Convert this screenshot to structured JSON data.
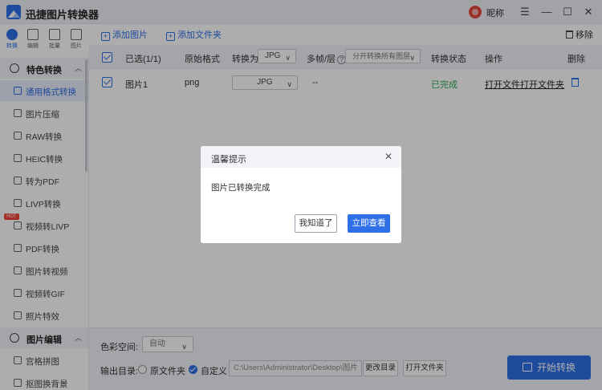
{
  "window": {
    "title": "迅捷图片转换器",
    "user_name": "昵称",
    "menu_glyph": "☰",
    "minimize_glyph": "—",
    "maximize_glyph": "☐",
    "close_glyph": "✕"
  },
  "rail": [
    {
      "label": "转换",
      "icon": "convert-icon",
      "active": true
    },
    {
      "label": "编辑",
      "icon": "edit-icon",
      "active": false
    },
    {
      "label": "批量",
      "icon": "batch-icon",
      "active": false
    },
    {
      "label": "图片",
      "icon": "image-icon",
      "active": false
    }
  ],
  "sidebar": {
    "section1": "特色转换",
    "items": [
      {
        "label": "通用格式转换",
        "active": true
      },
      {
        "label": "图片压缩"
      },
      {
        "label": "RAW转换"
      },
      {
        "label": "HEIC转换"
      },
      {
        "label": "转为PDF"
      },
      {
        "label": "LIVP转换"
      },
      {
        "label": "视频转LIVP",
        "badge": "HOT"
      },
      {
        "label": "PDF转换"
      },
      {
        "label": "图片转视频"
      },
      {
        "label": "视频转GIF"
      },
      {
        "label": "照片特效"
      }
    ],
    "section2": "图片编辑",
    "items2": [
      {
        "label": "宫格拼图"
      },
      {
        "label": "抠图换背景"
      }
    ],
    "chevron_glyph": "︿"
  },
  "toolbar": {
    "add_image": "添加图片",
    "add_folder": "添加文件夹",
    "remove": "移除"
  },
  "table": {
    "selected": "已选(1/1)",
    "col_format": "原始格式",
    "col_convert_to": "转换为",
    "convert_to_value": "JPG",
    "col_multiframe": "多帧/层",
    "help_glyph": "?",
    "multiframe_value": "分开转换所有图层",
    "col_status": "转换状态",
    "col_action": "操作",
    "col_delete": "删除",
    "caret_glyph": "∨",
    "rows": [
      {
        "name": "图片1",
        "format": "png",
        "convert_to": "JPG",
        "multiframe": "--",
        "status": "已完成",
        "open_file": "打开文件",
        "open_folder": "打开文件夹"
      }
    ]
  },
  "bottom": {
    "color_space_label": "色彩空间:",
    "color_space_value": "自动",
    "output_label": "输出目录:",
    "opt_original": "原文件夹",
    "opt_custom": "自定义",
    "path": "C:\\Users\\Administrator\\Desktop\\图片",
    "change_dir": "更改目录",
    "open_folder": "打开文件夹",
    "start": "开始转换"
  },
  "modal": {
    "title": "温馨提示",
    "message": "图片已转换完成",
    "ok": "我知道了",
    "view": "立即查看",
    "close_glyph": "✕"
  },
  "colors": {
    "accent": "#2f6fe8",
    "success": "#2fa84f",
    "hot": "#f0443a"
  }
}
